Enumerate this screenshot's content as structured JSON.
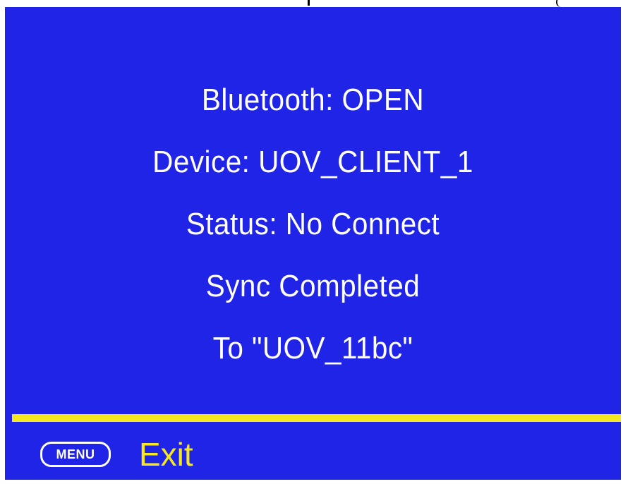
{
  "colors": {
    "panel_background": "#1f24e6",
    "text": "#ffffff",
    "accent": "#f5e81e"
  },
  "info": {
    "bluetooth": "Bluetooth: OPEN",
    "device": "Device: UOV_CLIENT_1",
    "status": "Status: No Connect",
    "sync": "Sync Completed",
    "target": "To \"UOV_11bc\""
  },
  "footer": {
    "menu_key_label": "MENU",
    "menu_key_icon": "menu-key-icon",
    "exit_label": "Exit"
  }
}
